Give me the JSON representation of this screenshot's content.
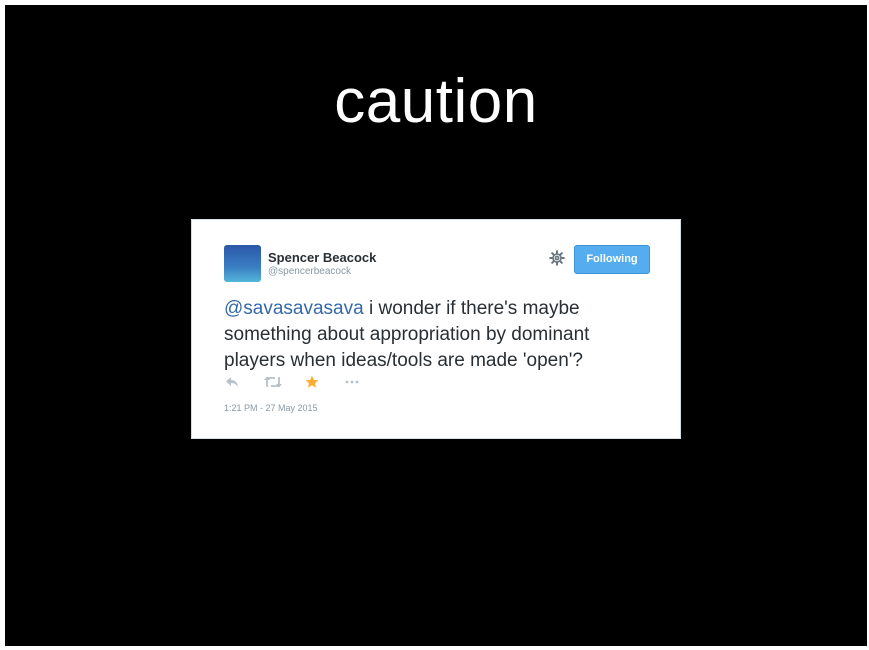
{
  "slide": {
    "title": "caution",
    "background_color": "#000000"
  },
  "tweet": {
    "author": {
      "name": "Spencer Beacock",
      "handle": "@spencerbeacock",
      "avatar_colors": [
        "#2a57a8",
        "#53b6d8"
      ]
    },
    "settings_icon": "gear-icon",
    "follow_button_label": "Following",
    "follow_button_color": "#55acee",
    "mention": "@savasavasava",
    "text": " i wonder if there's maybe something about appropriation by dominant players when ideas/tools are made 'open'?",
    "actions": {
      "reply_icon": "reply-icon",
      "retweet_icon": "retweet-icon",
      "favorite_icon": "star-icon",
      "favorite_color": "#ffac33",
      "more_icon": "more-icon"
    },
    "timestamp": "1:21 PM - 27 May 2015"
  }
}
